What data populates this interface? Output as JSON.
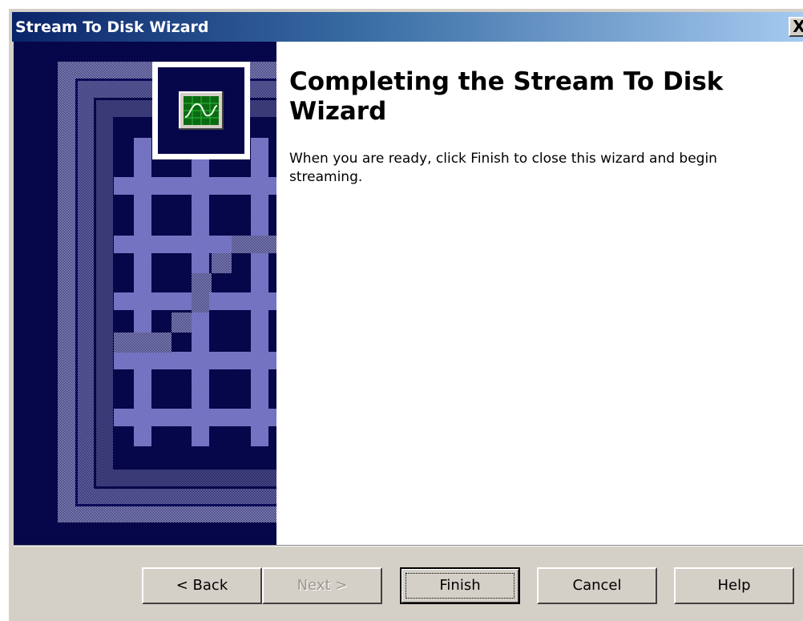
{
  "window": {
    "title": "Stream To Disk Wizard",
    "close_label": "X"
  },
  "content": {
    "heading": "Completing the Stream To Disk Wizard",
    "body": "When you are ready, click Finish to close this wizard and begin streaming."
  },
  "buttons": {
    "back": "< Back",
    "next": "Next >",
    "finish": "Finish",
    "cancel": "Cancel",
    "help": "Help"
  },
  "colors": {
    "title_gradient_start": "#0a246a",
    "title_gradient_end": "#a6caf0",
    "dialog_face": "#d4d0c8",
    "graphic_background": "#06064a",
    "graphic_pattern": "#7a7ac8",
    "monitor_screen": "#0b6b12"
  },
  "icons": {
    "wizard_graphic": "monitor-waveform-icon"
  }
}
